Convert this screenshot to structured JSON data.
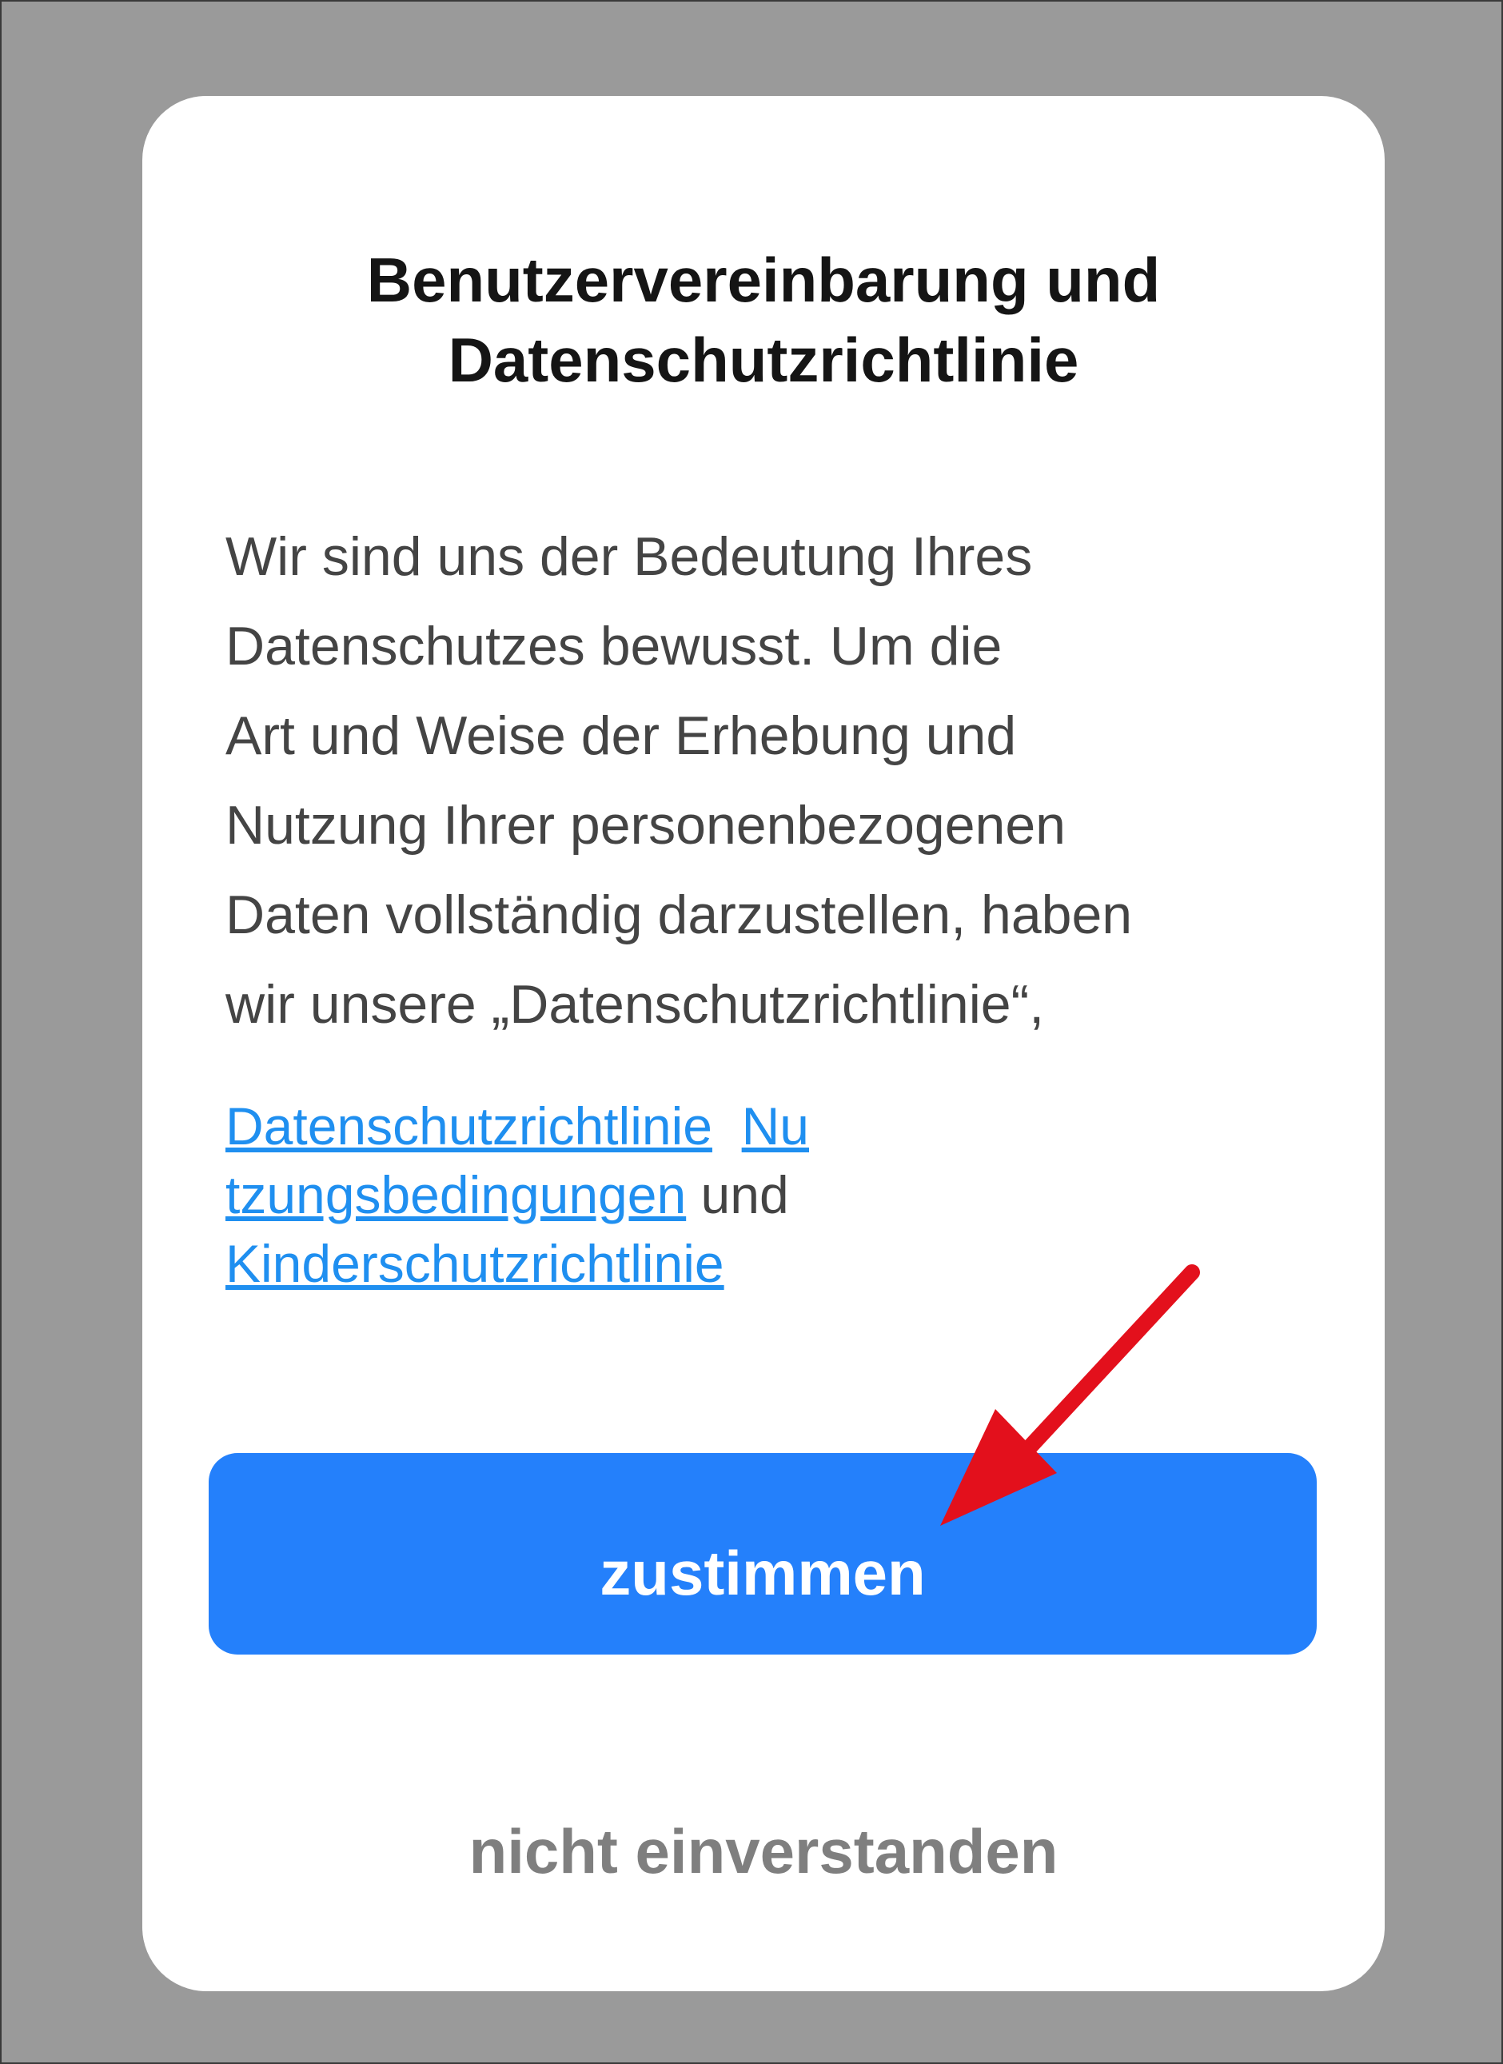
{
  "dialog": {
    "title_line1": "Benutzervereinbarung und",
    "title_line2": "Datenschutzrichtlinie",
    "body_lines": [
      "Wir sind uns der Bedeutung Ihres",
      "Datenschutzes bewusst. Um die",
      "Art und Weise der Erhebung und",
      "Nutzung Ihrer personenbezogenen",
      "Daten vollständig darzustellen, haben",
      "wir unsere „Datenschutzrichtlinie“,"
    ],
    "links": {
      "privacy_policy": "Datenschutzrichtlinie",
      "terms_part1": "Nu",
      "terms_part2": "tzungsbedingungen",
      "connector": "und",
      "child_protection": "Kinderschutzrichtlinie"
    },
    "agree_label": "zustimmen",
    "decline_label": "nicht einverstanden"
  },
  "colors": {
    "backdrop": "#9a9a9a",
    "primary_button": "#2480fb",
    "link": "#1f8ff0",
    "annotation_arrow": "#e3101c"
  },
  "annotation": {
    "icon": "red-arrow-icon",
    "points_to": "agree-button"
  }
}
